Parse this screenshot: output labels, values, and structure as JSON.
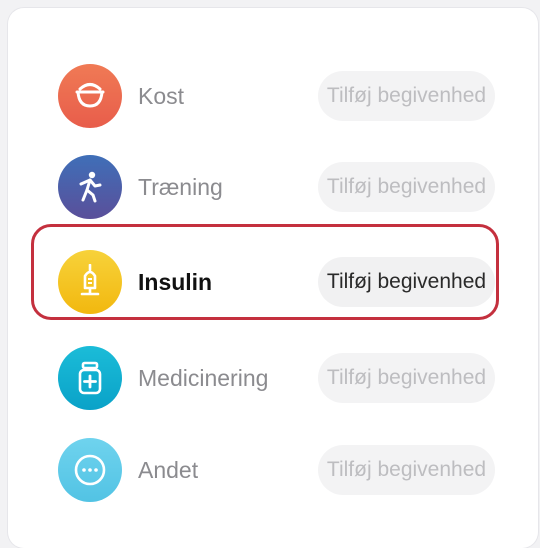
{
  "rows": [
    {
      "label": "Kost",
      "button": "Tilføj begivenhed",
      "icon": "bowl-icon",
      "color": "#ee6a50"
    },
    {
      "label": "Træning",
      "button": "Tilføj begivenhed",
      "icon": "running-person-icon",
      "color": "#4d5fa6"
    },
    {
      "label": "Insulin",
      "button": "Tilføj begivenhed",
      "icon": "syringe-icon",
      "color": "#f5c518"
    },
    {
      "label": "Medicinering",
      "button": "Tilføj begivenhed",
      "icon": "medicine-bottle-icon",
      "color": "#10aed0"
    },
    {
      "label": "Andet",
      "button": "Tilføj begivenhed",
      "icon": "more-dots-icon",
      "color": "#5fcbe8"
    }
  ],
  "highlight": {
    "row": "Insulin",
    "color": "#c4303e"
  }
}
